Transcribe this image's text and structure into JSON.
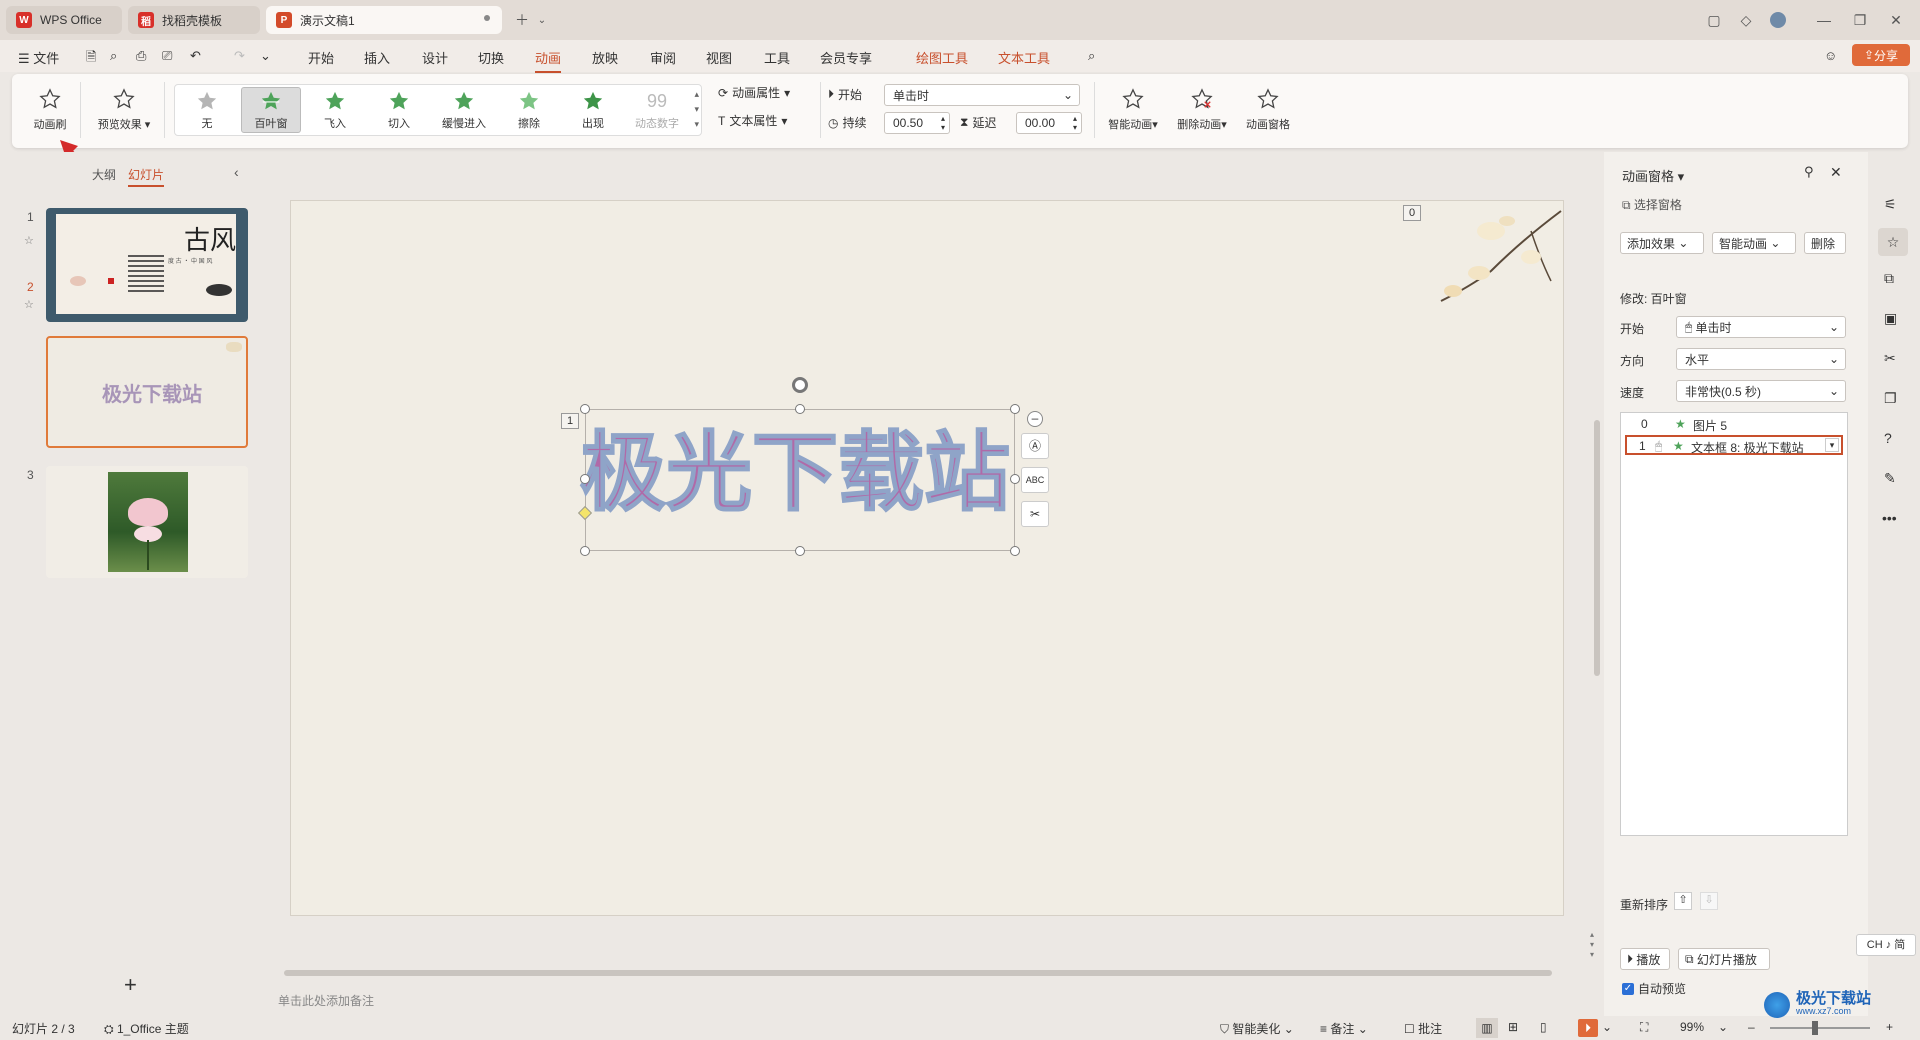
{
  "titlebar": {
    "tabs": [
      {
        "label": "WPS Office"
      },
      {
        "label": "找稻壳模板"
      },
      {
        "label": "演示文稿1"
      }
    ]
  },
  "menubar": {
    "file": "文件",
    "items": [
      "开始",
      "插入",
      "设计",
      "切换",
      "动画",
      "放映",
      "审阅",
      "视图",
      "工具",
      "会员专享",
      "绘图工具",
      "文本工具"
    ],
    "active": "动画",
    "share": "分享"
  },
  "ribbon": {
    "anim_brush": "动画刷",
    "preview": "预览效果",
    "gallery": [
      "无",
      "百叶窗",
      "飞入",
      "切入",
      "缓慢进入",
      "擦除",
      "出现",
      "动态数字"
    ],
    "anim_props": "动画属性",
    "text_props": "文本属性",
    "start_label": "开始",
    "start_value": "单击时",
    "duration_label": "持续",
    "duration_value": "00.50",
    "delay_label": "延迟",
    "delay_value": "00.00",
    "smart_anim": "智能动画",
    "delete_anim": "删除动画",
    "anim_pane": "动画窗格"
  },
  "leftpane": {
    "outline_tab": "大纲",
    "slides_tab": "幻灯片",
    "slides": [
      {
        "num": "1",
        "title_text": "古风",
        "subtitle_text": "度 古 ・ 中 国 风"
      },
      {
        "num": "2",
        "title_text": "极光下载站"
      },
      {
        "num": "3"
      }
    ]
  },
  "slide": {
    "title": "极光下载站",
    "anim_tag_0": "0",
    "anim_tag_1": "1"
  },
  "notes": {
    "placeholder": "单击此处添加备注"
  },
  "rightpane": {
    "title": "动画窗格",
    "select_pane": "选择窗格",
    "add_effect": "添加效果",
    "smart_anim": "智能动画",
    "delete": "删除",
    "modify": "修改: 百叶窗",
    "start_label": "开始",
    "start_value": "单击时",
    "direction_label": "方向",
    "direction_value": "水平",
    "speed_label": "速度",
    "speed_value": "非常快(0.5 秒)",
    "list": [
      {
        "idx": "0",
        "label": "图片 5"
      },
      {
        "idx": "1",
        "label": "文本框 8: 极光下载站"
      }
    ],
    "reorder": "重新排序",
    "play": "播放",
    "slideshow": "幻灯片播放",
    "autopreview": "自动预览"
  },
  "statusbar": {
    "slide_info": "幻灯片 2 / 3",
    "theme": "1_Office 主题",
    "beautify": "智能美化",
    "notes": "备注",
    "comment": "批注",
    "zoom": "99%",
    "ime": "CH ♪ 简"
  },
  "watermark": "极光下载站",
  "watermark_url": "www.xz7.com",
  "colors": {
    "accent": "#c8502d",
    "text_fill": "#b06aa8",
    "text_outline": "#8fa4c8"
  }
}
